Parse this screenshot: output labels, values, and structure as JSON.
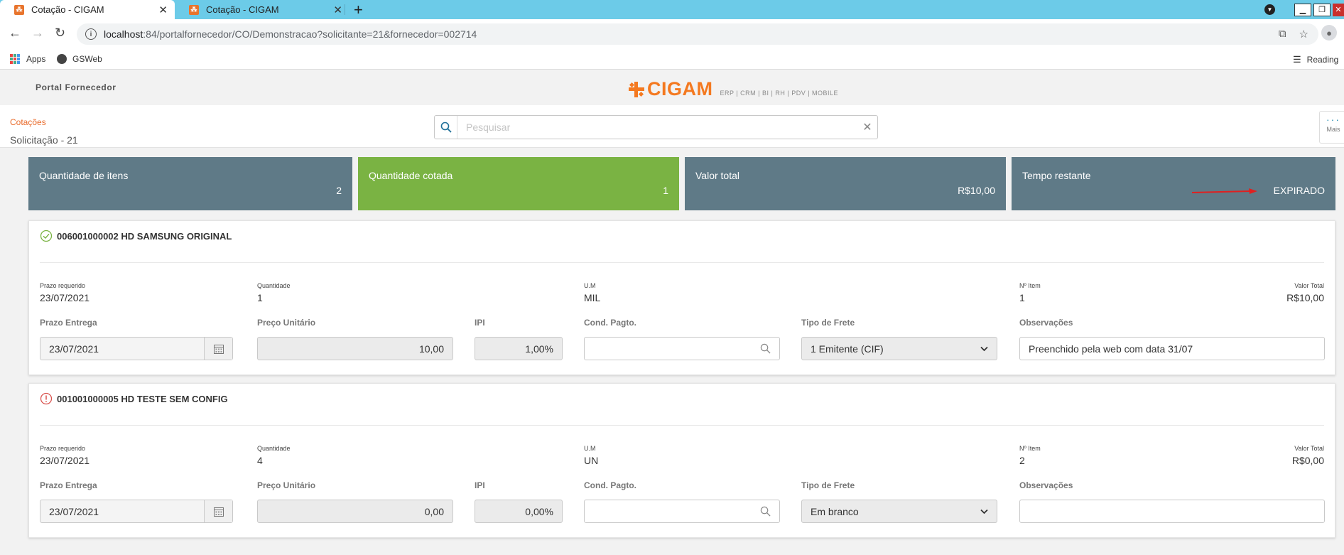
{
  "browser": {
    "tabs": [
      {
        "title": "Cotação - CIGAM",
        "close": "✕"
      },
      {
        "title": "Cotação - CIGAM",
        "close": "✕"
      }
    ],
    "new_tab": "+",
    "url_host": "localhost",
    "url_rest": ":84/portalfornecedor/CO/Demonstracao?solicitante=21&fornecedor=002714",
    "bookmarks": [
      {
        "label": "Apps"
      },
      {
        "label": "GSWeb"
      }
    ],
    "reading_list": "Reading"
  },
  "header": {
    "portal_label": "Portal Fornecedor",
    "logo_text": "CIGAM",
    "logo_subtitle": "ERP | CRM | BI | RH | PDV | MOBILE"
  },
  "subheader": {
    "breadcrumb_link": "Cotações",
    "page_title": "Solicitação - 21",
    "search_placeholder": "Pesquisar",
    "more_label": "Mais",
    "more_dots": "···"
  },
  "stats": [
    {
      "label": "Quantidade de itens",
      "value": "2",
      "color": "#5f7a87"
    },
    {
      "label": "Quantidade cotada",
      "value": "1",
      "color": "#7ab343"
    },
    {
      "label": "Valor total",
      "value": "R$10,00",
      "color": "#5f7a87"
    },
    {
      "label": "Tempo restante",
      "value": "EXPIRADO",
      "color": "#5f7a87"
    }
  ],
  "field_labels": {
    "prazo_requerido": "Prazo requerido",
    "quantidade": "Quantidade",
    "um": "U.M",
    "n_item": "Nº Item",
    "valor_total": "Valor Total",
    "prazo_entrega": "Prazo Entrega",
    "preco_unitario": "Preço Unitário",
    "ipi": "IPI",
    "cond_pagto": "Cond. Pagto.",
    "tipo_frete": "Tipo de Frete",
    "observacoes": "Observações"
  },
  "items": [
    {
      "status": "ok",
      "status_color": "#7ab343",
      "title": "006001000002 HD SAMSUNG ORIGINAL",
      "prazo_requerido": "23/07/2021",
      "quantidade": "1",
      "um": "MIL",
      "n_item": "1",
      "valor_total": "R$10,00",
      "prazo_entrega": "23/07/2021",
      "preco_unitario": "10,00",
      "ipi": "1,00%",
      "cond_pagto": "",
      "tipo_frete": "1 Emitente (CIF)",
      "observacoes": "Preenchido pela web com data 31/07"
    },
    {
      "status": "warning",
      "status_color": "#d9534f",
      "title": "001001000005 HD TESTE SEM CONFIG",
      "prazo_requerido": "23/07/2021",
      "quantidade": "4",
      "um": "UN",
      "n_item": "2",
      "valor_total": "R$0,00",
      "prazo_entrega": "23/07/2021",
      "preco_unitario": "0,00",
      "ipi": "0,00%",
      "cond_pagto": "",
      "tipo_frete": "Em branco",
      "observacoes": ""
    }
  ],
  "colors": {
    "accent_orange": "#f47920",
    "tab_bar": "#6ccbe8",
    "annotation_arrow": "#e02020"
  }
}
